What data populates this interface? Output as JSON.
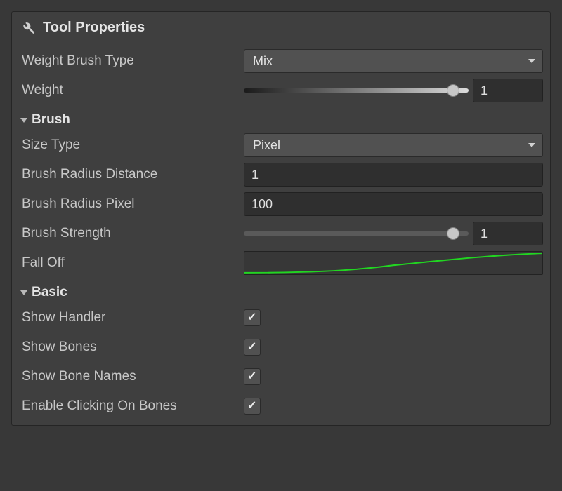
{
  "header": {
    "title": "Tool Properties"
  },
  "weightBrushType": {
    "label": "Weight Brush Type",
    "value": "Mix"
  },
  "weight": {
    "label": "Weight",
    "value": "1",
    "position": 93
  },
  "sections": {
    "brush": {
      "title": "Brush"
    },
    "basic": {
      "title": "Basic"
    }
  },
  "sizeType": {
    "label": "Size Type",
    "value": "Pixel"
  },
  "brushRadiusDistance": {
    "label": "Brush Radius Distance",
    "value": "1"
  },
  "brushRadiusPixel": {
    "label": "Brush Radius Pixel",
    "value": "100"
  },
  "brushStrength": {
    "label": "Brush Strength",
    "value": "1",
    "position": 93
  },
  "fallOff": {
    "label": "Fall Off",
    "curveColor": "#21d621"
  },
  "showHandler": {
    "label": "Show Handler",
    "checked": true
  },
  "showBones": {
    "label": "Show Bones",
    "checked": true
  },
  "showBoneNames": {
    "label": "Show Bone Names",
    "checked": true
  },
  "enableClickingOnBones": {
    "label": "Enable Clicking On Bones",
    "checked": true
  }
}
